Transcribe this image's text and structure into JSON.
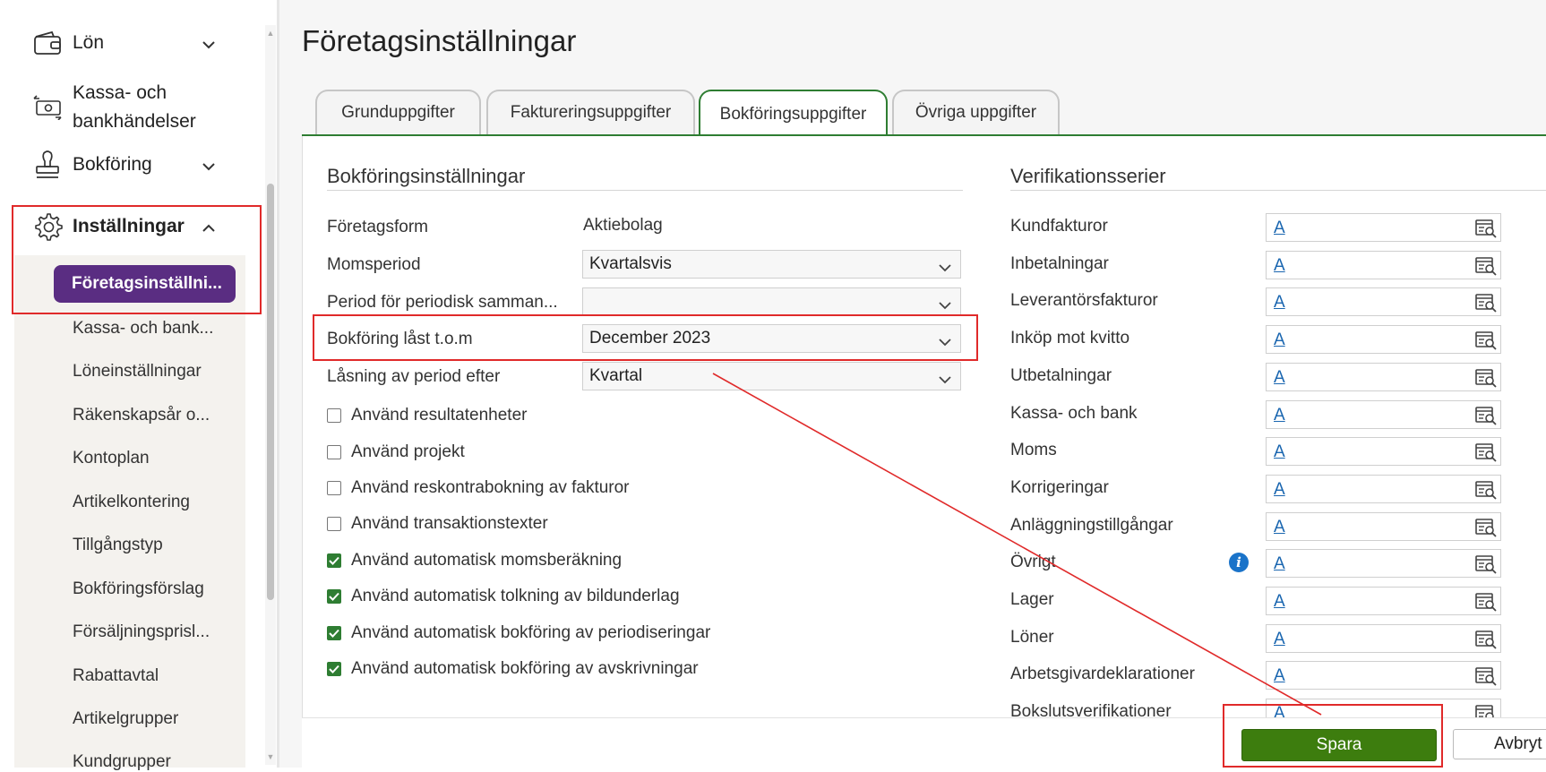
{
  "sidebar": {
    "nav": [
      {
        "label": "Lön",
        "icon": "wallet-icon",
        "has_chevron": true
      },
      {
        "label_line1": "Kassa- och",
        "label_line2": "bankhändelser",
        "icon": "cash-transfer-icon"
      },
      {
        "label": "Bokföring",
        "icon": "stamp-icon",
        "has_chevron": true
      },
      {
        "label": "Inställningar",
        "icon": "gear-icon",
        "expanded": true
      }
    ],
    "active_subitem": "Företagsinställni...",
    "subitems": [
      "Kassa- och bank...",
      "Löneinställningar",
      "Räkenskapsår o...",
      "Kontoplan",
      "Artikelkontering",
      "Tillgångstyp",
      "Bokföringsförslag",
      "Försäljningsprisl...",
      "Rabattavtal",
      "Artikelgrupper",
      "Kundgrupper"
    ]
  },
  "page_title": "Företagsinställningar",
  "tabs": [
    {
      "label": "Grunduppgifter",
      "active": false
    },
    {
      "label": "Faktureringsuppgifter",
      "active": false
    },
    {
      "label": "Bokföringsuppgifter",
      "active": true
    },
    {
      "label": "Övriga uppgifter",
      "active": false
    }
  ],
  "bookkeeping": {
    "title": "Bokföringsinställningar",
    "fields": {
      "foretagsform": {
        "label": "Företagsform",
        "value": "Aktiebolag"
      },
      "momsperiod": {
        "label": "Momsperiod",
        "value": "Kvartalsvis"
      },
      "periodisk": {
        "label": "Period för periodisk samman...",
        "value": ""
      },
      "last": {
        "label": "Bokföring låst t.o.m",
        "value": "December 2023"
      },
      "lasning": {
        "label": "Låsning av period efter",
        "value": "Kvartal"
      }
    },
    "checkboxes": [
      {
        "label": "Använd resultatenheter",
        "checked": false
      },
      {
        "label": "Använd projekt",
        "checked": false
      },
      {
        "label": "Använd reskontrabokning av fakturor",
        "checked": false
      },
      {
        "label": "Använd transaktionstexter",
        "checked": false
      },
      {
        "label": "Använd automatisk momsberäkning",
        "checked": true
      },
      {
        "label": "Använd automatisk tolkning av bildunderlag",
        "checked": true
      },
      {
        "label": "Använd automatisk bokföring av periodiseringar",
        "checked": true
      },
      {
        "label": "Använd automatisk bokföring av avskrivningar",
        "checked": true
      }
    ]
  },
  "verification": {
    "title": "Verifikationsserier",
    "rows": [
      {
        "label": "Kundfakturor",
        "value": "A"
      },
      {
        "label": "Inbetalningar",
        "value": "A"
      },
      {
        "label": "Leverantörsfakturor",
        "value": "A"
      },
      {
        "label": "Inköp mot kvitto",
        "value": "A"
      },
      {
        "label": "Utbetalningar",
        "value": "A"
      },
      {
        "label": "Kassa- och bank",
        "value": "A"
      },
      {
        "label": "Moms",
        "value": "A"
      },
      {
        "label": "Korrigeringar",
        "value": "A"
      },
      {
        "label": "Anläggningstillgångar",
        "value": "A"
      },
      {
        "label": "Övrigt",
        "value": "A"
      },
      {
        "label": "Lager",
        "value": "A"
      },
      {
        "label": "Löner",
        "value": "A"
      },
      {
        "label": "Arbetsgivardeklarationer",
        "value": "A"
      },
      {
        "label": "Bokslutsverifikationer",
        "value": "A"
      }
    ]
  },
  "buttons": {
    "save": "Spara",
    "cancel": "Avbryt"
  },
  "colors": {
    "brand_purple": "#5a2d82",
    "accent_green": "#2e7d32",
    "save_green": "#3d7d0e",
    "annotation_red": "#e02a2a",
    "link_blue": "#1a66b0"
  }
}
